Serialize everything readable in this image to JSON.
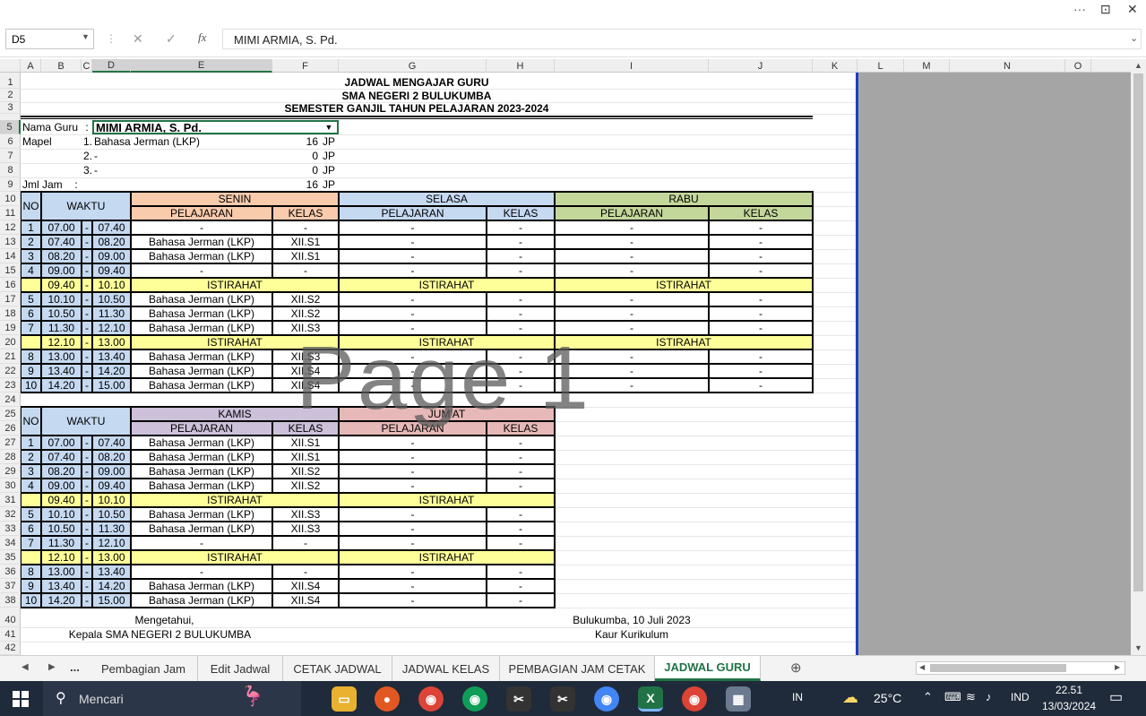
{
  "window": {
    "more_label": "···",
    "restore_label": "⊡",
    "close_label": "✕"
  },
  "formula": {
    "name_box": "D5",
    "cancel": "✕",
    "confirm": "✓",
    "fx": "fx",
    "value": "MIMI ARMIA, S. Pd."
  },
  "columns": [
    "A",
    "B",
    "C",
    "D",
    "E",
    "F",
    "G",
    "H",
    "I",
    "J",
    "K",
    "L",
    "M",
    "N",
    "O"
  ],
  "rows": [
    "1",
    "2",
    "3",
    "5",
    "6",
    "7",
    "8",
    "9",
    "10",
    "11",
    "12",
    "13",
    "14",
    "15",
    "16",
    "17",
    "18",
    "19",
    "20",
    "21",
    "22",
    "23",
    "24",
    "25",
    "26",
    "27",
    "28",
    "29",
    "30",
    "31",
    "32",
    "33",
    "34",
    "35",
    "36",
    "37",
    "38",
    "40",
    "41",
    "42"
  ],
  "header": {
    "line1": "JADWAL MENGAJAR GURU",
    "line2": "SMA NEGERI 2 BULUKUMBA",
    "line3": "SEMESTER GANJIL TAHUN PELAJARAN 2023-2024"
  },
  "info": {
    "nama_label": "Nama Guru",
    "colon": ":",
    "nama_value": "MIMI ARMIA, S. Pd.",
    "mapel_label": "Mapel",
    "mapel": [
      {
        "num": "1.",
        "name": "Bahasa Jerman (LKP)",
        "jp": "16",
        "unit": "JP"
      },
      {
        "num": "2.",
        "name": "-",
        "jp": "0",
        "unit": "JP"
      },
      {
        "num": "3.",
        "name": "-",
        "jp": "0",
        "unit": "JP"
      }
    ],
    "jml_label": "Jml Jam",
    "jml_value": "16",
    "jml_unit": "JP"
  },
  "table1": {
    "no": "NO",
    "waktu": "WAKTU",
    "days": [
      "SENIN",
      "SELASA",
      "RABU"
    ],
    "pelajaran": "PELAJARAN",
    "kelas": "KELAS",
    "rows": [
      {
        "no": "1",
        "start": "07.00",
        "dash": "-",
        "end": "07.40",
        "cells": [
          "-",
          "-",
          "-",
          "-",
          "-",
          "-"
        ]
      },
      {
        "no": "2",
        "start": "07.40",
        "dash": "-",
        "end": "08.20",
        "cells": [
          "Bahasa Jerman (LKP)",
          "XII.S1",
          "-",
          "-",
          "-",
          "-"
        ]
      },
      {
        "no": "3",
        "start": "08.20",
        "dash": "-",
        "end": "09.00",
        "cells": [
          "Bahasa Jerman (LKP)",
          "XII.S1",
          "-",
          "-",
          "-",
          "-"
        ]
      },
      {
        "no": "4",
        "start": "09.00",
        "dash": "-",
        "end": "09.40",
        "cells": [
          "-",
          "-",
          "-",
          "-",
          "-",
          "-"
        ]
      },
      {
        "no": "",
        "start": "09.40",
        "dash": "-",
        "end": "10.10",
        "break": "ISTIRAHAT"
      },
      {
        "no": "5",
        "start": "10.10",
        "dash": "-",
        "end": "10.50",
        "cells": [
          "Bahasa Jerman (LKP)",
          "XII.S2",
          "-",
          "-",
          "-",
          "-"
        ]
      },
      {
        "no": "6",
        "start": "10.50",
        "dash": "-",
        "end": "11.30",
        "cells": [
          "Bahasa Jerman (LKP)",
          "XII.S2",
          "-",
          "-",
          "-",
          "-"
        ]
      },
      {
        "no": "7",
        "start": "11.30",
        "dash": "-",
        "end": "12.10",
        "cells": [
          "Bahasa Jerman (LKP)",
          "XII.S3",
          "-",
          "-",
          "-",
          "-"
        ]
      },
      {
        "no": "",
        "start": "12.10",
        "dash": "-",
        "end": "13.00",
        "break": "ISTIRAHAT"
      },
      {
        "no": "8",
        "start": "13.00",
        "dash": "-",
        "end": "13.40",
        "cells": [
          "Bahasa Jerman (LKP)",
          "XII.S3",
          "-",
          "-",
          "-",
          "-"
        ]
      },
      {
        "no": "9",
        "start": "13.40",
        "dash": "-",
        "end": "14.20",
        "cells": [
          "Bahasa Jerman (LKP)",
          "XII.S4",
          "-",
          "-",
          "-",
          "-"
        ]
      },
      {
        "no": "10",
        "start": "14.20",
        "dash": "-",
        "end": "15.00",
        "cells": [
          "Bahasa Jerman (LKP)",
          "XII.S4",
          "-",
          "-",
          "-",
          "-"
        ]
      }
    ]
  },
  "table2": {
    "no": "NO",
    "waktu": "WAKTU",
    "days": [
      "KAMIS",
      "JUM'AT"
    ],
    "pelajaran": "PELAJARAN",
    "kelas": "KELAS",
    "rows": [
      {
        "no": "1",
        "start": "07.00",
        "dash": "-",
        "end": "07.40",
        "cells": [
          "Bahasa Jerman (LKP)",
          "XII.S1",
          "-",
          "-"
        ]
      },
      {
        "no": "2",
        "start": "07.40",
        "dash": "-",
        "end": "08.20",
        "cells": [
          "Bahasa Jerman (LKP)",
          "XII.S1",
          "-",
          "-"
        ]
      },
      {
        "no": "3",
        "start": "08.20",
        "dash": "-",
        "end": "09.00",
        "cells": [
          "Bahasa Jerman (LKP)",
          "XII.S2",
          "-",
          "-"
        ]
      },
      {
        "no": "4",
        "start": "09.00",
        "dash": "-",
        "end": "09.40",
        "cells": [
          "Bahasa Jerman (LKP)",
          "XII.S2",
          "-",
          "-"
        ]
      },
      {
        "no": "",
        "start": "09.40",
        "dash": "-",
        "end": "10.10",
        "break": "ISTIRAHAT"
      },
      {
        "no": "5",
        "start": "10.10",
        "dash": "-",
        "end": "10.50",
        "cells": [
          "Bahasa Jerman (LKP)",
          "XII.S3",
          "-",
          "-"
        ]
      },
      {
        "no": "6",
        "start": "10.50",
        "dash": "-",
        "end": "11.30",
        "cells": [
          "Bahasa Jerman (LKP)",
          "XII.S3",
          "-",
          "-"
        ]
      },
      {
        "no": "7",
        "start": "11.30",
        "dash": "-",
        "end": "12.10",
        "cells": [
          "-",
          "-",
          "-",
          "-"
        ]
      },
      {
        "no": "",
        "start": "12.10",
        "dash": "-",
        "end": "13.00",
        "break": "ISTIRAHAT"
      },
      {
        "no": "8",
        "start": "13.00",
        "dash": "-",
        "end": "13.40",
        "cells": [
          "-",
          "-",
          "-",
          "-"
        ]
      },
      {
        "no": "9",
        "start": "13.40",
        "dash": "-",
        "end": "14.20",
        "cells": [
          "Bahasa Jerman (LKP)",
          "XII.S4",
          "-",
          "-"
        ]
      },
      {
        "no": "10",
        "start": "14.20",
        "dash": "-",
        "end": "15.00",
        "cells": [
          "Bahasa Jerman (LKP)",
          "XII.S4",
          "-",
          "-"
        ]
      }
    ]
  },
  "footer": {
    "left1": "Mengetahui,",
    "left2": "Kepala SMA NEGERI 2 BULUKUMBA",
    "right1": "Bulukumba, 10 Juli 2023",
    "right2": "Kaur Kurikulum"
  },
  "watermark": "Page 1",
  "tabs": {
    "ellipsis": "...",
    "items": [
      "Pembagian Jam",
      "Edit Jadwal",
      "CETAK JADWAL",
      "JADWAL KELAS",
      "PEMBAGIAN JAM CETAK",
      "JADWAL GURU"
    ]
  },
  "taskbar": {
    "search": "Mencari",
    "lang": "IN",
    "weather": "25°C",
    "ime": "IND",
    "time": "22.51",
    "date": "13/03/2024"
  },
  "colors": {
    "senin": "#f8cbad",
    "selasa": "#c5d9f1",
    "rabu": "#c4d79b",
    "kamis": "#ccc0da",
    "jumat": "#e6b8b7",
    "istirahat": "#ffff99",
    "waktu": "#c5d9f1",
    "excel_green": "#217346"
  }
}
